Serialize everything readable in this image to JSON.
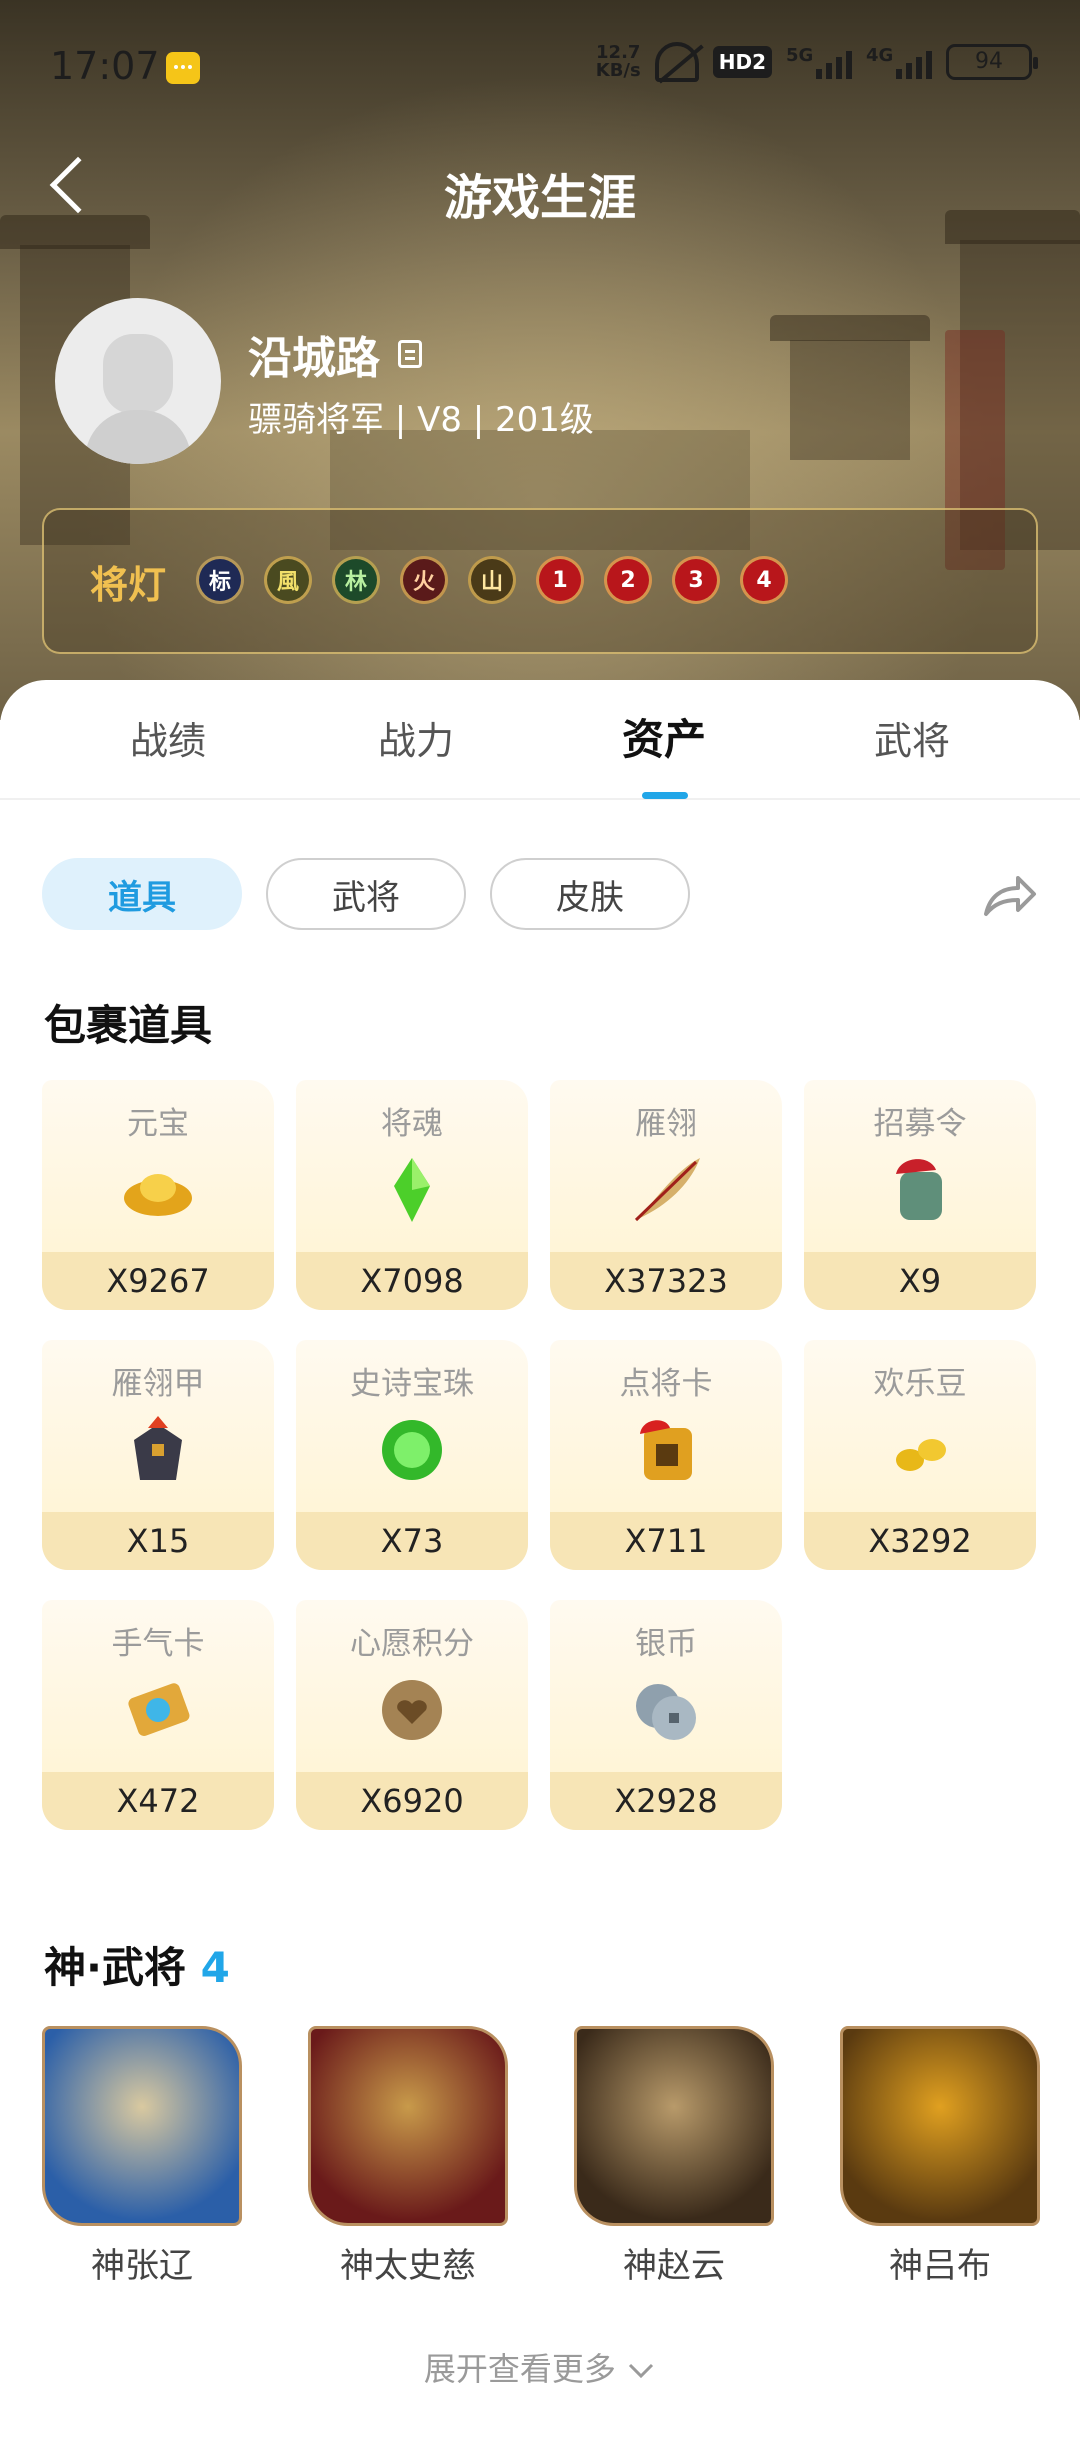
{
  "status_bar": {
    "time": "17:07",
    "net_speed_value": "12.7",
    "net_speed_unit": "KB/s",
    "hd_label": "HD2",
    "signal1_label": "5G",
    "signal2_label": "4G",
    "battery": "94"
  },
  "header": {
    "title": "游戏生涯",
    "back_icon": "chevron-left-icon"
  },
  "profile": {
    "username": "沿城路",
    "rank_line": "骠骑将军 | V8 | 201级"
  },
  "lamp_panel": {
    "title": "将灯",
    "lamps": [
      {
        "label": "标",
        "bg": "#1f2a55",
        "color": "#ffffff"
      },
      {
        "label": "風",
        "bg": "#4a4a20",
        "color": "#f2e06a"
      },
      {
        "label": "林",
        "bg": "#1d4a2a",
        "color": "#b8f0a0"
      },
      {
        "label": "火",
        "bg": "#5a1a1a",
        "color": "#ffd0a0"
      },
      {
        "label": "山",
        "bg": "#4a3a18",
        "color": "#ffe7a0"
      },
      {
        "label": "1",
        "bg": "#b8161b",
        "color": "#ffffff"
      },
      {
        "label": "2",
        "bg": "#b8161b",
        "color": "#ffffff"
      },
      {
        "label": "3",
        "bg": "#b8161b",
        "color": "#ffffff"
      },
      {
        "label": "4",
        "bg": "#b8161b",
        "color": "#ffffff"
      }
    ]
  },
  "tabs": [
    "战绩",
    "战力",
    "资产",
    "武将"
  ],
  "active_tab": "资产",
  "chips": [
    "道具",
    "武将",
    "皮肤"
  ],
  "active_chip": "道具",
  "bag_section": {
    "title": "包裹道具",
    "items": [
      {
        "name": "元宝",
        "count": "X9267",
        "icon": "gold-ingot-icon"
      },
      {
        "name": "将魂",
        "count": "X7098",
        "icon": "green-crystal-icon"
      },
      {
        "name": "雁翎",
        "count": "X37323",
        "icon": "feather-icon"
      },
      {
        "name": "招募令",
        "count": "X9",
        "icon": "recruit-token-icon"
      },
      {
        "name": "雁翎甲",
        "count": "X15",
        "icon": "armor-icon"
      },
      {
        "name": "史诗宝珠",
        "count": "X73",
        "icon": "green-orb-icon"
      },
      {
        "name": "点将卡",
        "count": "X711",
        "icon": "general-card-icon"
      },
      {
        "name": "欢乐豆",
        "count": "X3292",
        "icon": "gold-beans-icon"
      },
      {
        "name": "手气卡",
        "count": "X472",
        "icon": "luck-card-icon"
      },
      {
        "name": "心愿积分",
        "count": "X6920",
        "icon": "wish-coin-icon"
      },
      {
        "name": "银币",
        "count": "X2928",
        "icon": "silver-coin-icon"
      }
    ]
  },
  "generals_section": {
    "title": "神·武将",
    "count": "4",
    "generals": [
      {
        "name": "神张辽",
        "c1": "#2b5fa8",
        "c2": "#d9c9a0"
      },
      {
        "name": "神太史慈",
        "c1": "#6a1a1a",
        "c2": "#c89a4a"
      },
      {
        "name": "神赵云",
        "c1": "#3a2a1a",
        "c2": "#b89a6a"
      },
      {
        "name": "神吕布",
        "c1": "#5a3a10",
        "c2": "#e0a020"
      }
    ],
    "more_label": "展开查看更多"
  },
  "colors": {
    "accent": "#21a6e8",
    "lamp_title": "#f0c050",
    "item_bg": "#fff3cf",
    "item_count_bg": "#f7e5b6"
  }
}
